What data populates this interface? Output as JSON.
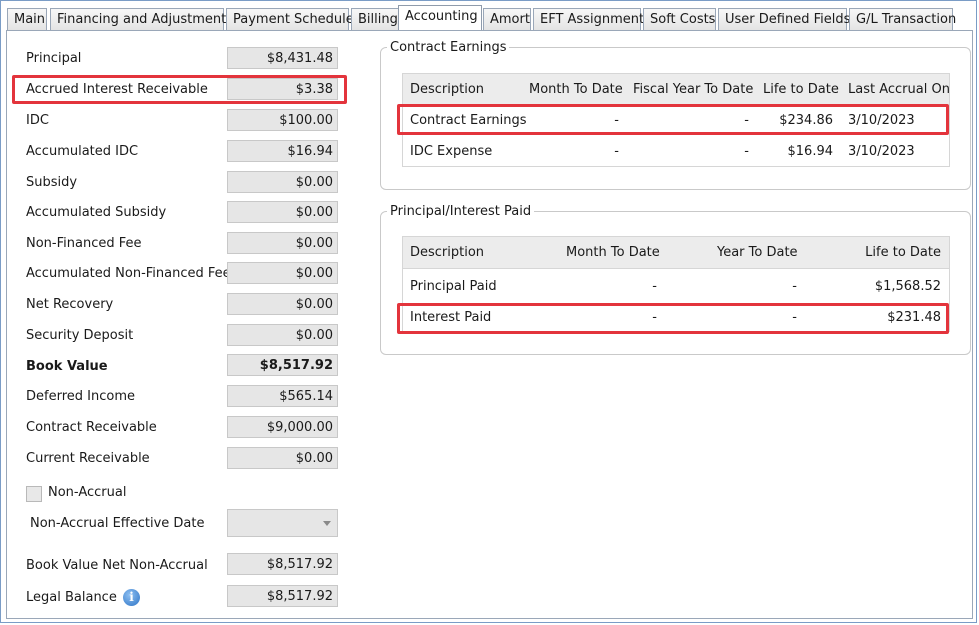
{
  "tabs": [
    "Main",
    "Financing and Adjustments",
    "Payment Schedule",
    "Billing",
    "Accounting",
    "Amort",
    "EFT Assignment",
    "Soft Costs",
    "User Defined Fields",
    "G/L Transaction"
  ],
  "active_tab": "Accounting",
  "fields": [
    {
      "label": "Principal",
      "value": "$8,431.48"
    },
    {
      "label": "Accrued Interest Receivable",
      "value": "$3.38"
    },
    {
      "label": "IDC",
      "value": "$100.00"
    },
    {
      "label": "Accumulated IDC",
      "value": "$16.94"
    },
    {
      "label": "Subsidy",
      "value": "$0.00"
    },
    {
      "label": "Accumulated Subsidy",
      "value": "$0.00"
    },
    {
      "label": "Non-Financed Fee",
      "value": "$0.00"
    },
    {
      "label": "Accumulated Non-Financed Fee",
      "value": "$0.00"
    },
    {
      "label": "Net Recovery",
      "value": "$0.00"
    },
    {
      "label": "Security Deposit",
      "value": "$0.00"
    },
    {
      "label": "Book Value",
      "value": "$8,517.92"
    },
    {
      "label": "Deferred Income",
      "value": "$565.14"
    },
    {
      "label": "Contract Receivable",
      "value": "$9,000.00"
    },
    {
      "label": "Current Receivable",
      "value": "$0.00"
    }
  ],
  "non_accrual": {
    "label": "Non-Accrual",
    "checked": false
  },
  "non_accrual_date": {
    "label": "Non-Accrual Effective Date",
    "value": ""
  },
  "book_value_net": {
    "label": "Book Value Net Non-Accrual",
    "value": "$8,517.92"
  },
  "legal_balance": {
    "label": "Legal Balance",
    "value": "$8,517.92",
    "info_icon": "i"
  },
  "contract_earnings": {
    "title": "Contract Earnings",
    "columns": [
      "Description",
      "Month To Date",
      "Fiscal Year To Date",
      "Life to Date",
      "Last Accrual On"
    ],
    "rows": [
      {
        "description": "Contract Earnings",
        "mtd": "-",
        "fytd": "-",
        "ltd": "$234.86",
        "last": "3/10/2023"
      },
      {
        "description": "IDC Expense",
        "mtd": "-",
        "fytd": "-",
        "ltd": "$16.94",
        "last": "3/10/2023"
      }
    ]
  },
  "principal_interest": {
    "title": "Principal/Interest Paid",
    "columns": [
      "Description",
      "Month To Date",
      "Year To Date",
      "Life to Date"
    ],
    "rows": [
      {
        "description": "Principal Paid",
        "mtd": "-",
        "ytd": "-",
        "ltd": "$1,568.52"
      },
      {
        "description": "Interest Paid",
        "mtd": "-",
        "ytd": "-",
        "ltd": "$231.48"
      }
    ]
  },
  "highlight_color": "#e3343c"
}
